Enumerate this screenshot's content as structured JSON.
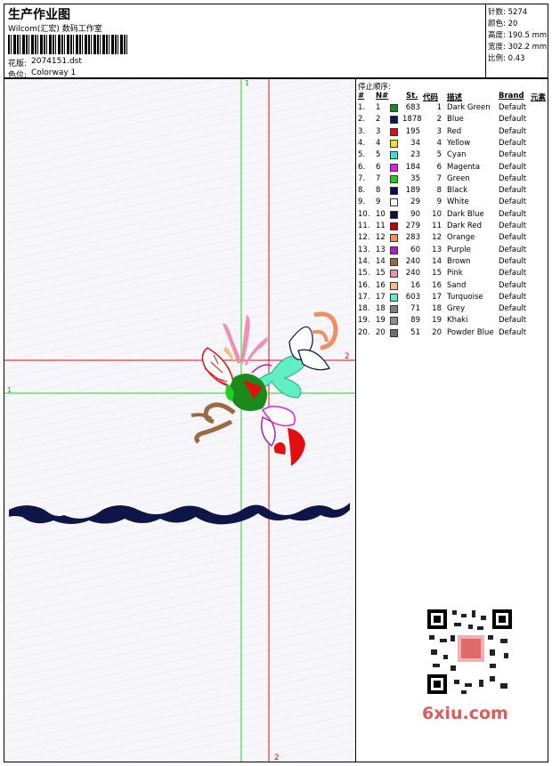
{
  "header": {
    "title": "生产作业图",
    "subtitle": "Wilcom(汇宏) 数码工作室",
    "design_label": "花版:",
    "design_value": "2074151.dst",
    "colorway_label": "色位:",
    "colorway_value": "Colorway 1"
  },
  "info": {
    "stitches_label": "针数:",
    "stitches_value": "5274",
    "colors_label": "颜色:",
    "colors_value": "20",
    "height_label": "高度:",
    "height_value": "190.5 mm",
    "width_label": "宽度:",
    "width_value": "302.2 mm",
    "scale_label": "比例:",
    "scale_value": "0.43"
  },
  "guides": {
    "v1": "1",
    "v2": "2",
    "h1": "1",
    "h2": "2"
  },
  "stop_table": {
    "title": "停止顺序:",
    "headers": {
      "num": "#",
      "n": "N#",
      "st": "St.",
      "code": "代码",
      "desc": "描述",
      "brand": "Brand",
      "elem": "元素"
    },
    "rows": [
      {
        "num": "1.",
        "n": "1",
        "color": "#1a8a1a",
        "st": "683",
        "code": "1",
        "desc": "Dark Green",
        "brand": "Default"
      },
      {
        "num": "2.",
        "n": "2",
        "color": "#0a1a5a",
        "st": "1878",
        "code": "2",
        "desc": "Blue",
        "brand": "Default"
      },
      {
        "num": "3.",
        "n": "3",
        "color": "#e01010",
        "st": "195",
        "code": "3",
        "desc": "Red",
        "brand": "Default"
      },
      {
        "num": "4.",
        "n": "4",
        "color": "#f0e020",
        "st": "34",
        "code": "4",
        "desc": "Yellow",
        "brand": "Default"
      },
      {
        "num": "5.",
        "n": "5",
        "color": "#40e0d0",
        "st": "23",
        "code": "5",
        "desc": "Cyan",
        "brand": "Default"
      },
      {
        "num": "6.",
        "n": "6",
        "color": "#e020e0",
        "st": "184",
        "code": "6",
        "desc": "Magenta",
        "brand": "Default"
      },
      {
        "num": "7.",
        "n": "7",
        "color": "#20d020",
        "st": "35",
        "code": "7",
        "desc": "Green",
        "brand": "Default"
      },
      {
        "num": "8.",
        "n": "8",
        "color": "#001050",
        "st": "189",
        "code": "8",
        "desc": "Black",
        "brand": "Default"
      },
      {
        "num": "9.",
        "n": "9",
        "color": "#ffffff",
        "st": "29",
        "code": "9",
        "desc": "White",
        "brand": "Default"
      },
      {
        "num": "10.",
        "n": "10",
        "color": "#101040",
        "st": "90",
        "code": "10",
        "desc": "Dark Blue",
        "brand": "Default"
      },
      {
        "num": "11.",
        "n": "11",
        "color": "#c00000",
        "st": "279",
        "code": "11",
        "desc": "Dark Red",
        "brand": "Default"
      },
      {
        "num": "12.",
        "n": "12",
        "color": "#f09060",
        "st": "283",
        "code": "12",
        "desc": "Orange",
        "brand": "Default"
      },
      {
        "num": "13.",
        "n": "13",
        "color": "#b020c0",
        "st": "60",
        "code": "13",
        "desc": "Purple",
        "brand": "Default"
      },
      {
        "num": "14.",
        "n": "14",
        "color": "#9a6a40",
        "st": "240",
        "code": "14",
        "desc": "Brown",
        "brand": "Default"
      },
      {
        "num": "15.",
        "n": "15",
        "color": "#f090b0",
        "st": "240",
        "code": "15",
        "desc": "Pink",
        "brand": "Default"
      },
      {
        "num": "16.",
        "n": "16",
        "color": "#f0c080",
        "st": "16",
        "code": "16",
        "desc": "Sand",
        "brand": "Default"
      },
      {
        "num": "17.",
        "n": "17",
        "color": "#60f0c0",
        "st": "603",
        "code": "17",
        "desc": "Turquoise",
        "brand": "Default"
      },
      {
        "num": "18.",
        "n": "18",
        "color": "#808080",
        "st": "71",
        "code": "18",
        "desc": "Grey",
        "brand": "Default"
      },
      {
        "num": "19.",
        "n": "19",
        "color": "#909090",
        "st": "89",
        "code": "19",
        "desc": "Khaki",
        "brand": "Default"
      },
      {
        "num": "20.",
        "n": "20",
        "color": "#707078",
        "st": "51",
        "code": "20",
        "desc": "Powder Blue",
        "brand": "Default"
      }
    ]
  },
  "watermark": "6xiu.com",
  "qr_stamp": "QR code"
}
